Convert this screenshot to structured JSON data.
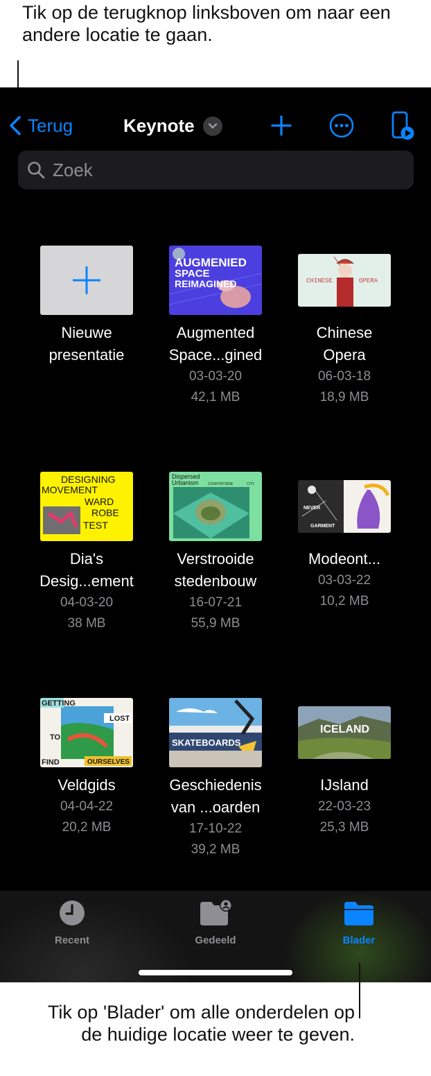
{
  "callouts": {
    "top": "Tik op de terugknop linksboven om naar een andere locatie te gaan.",
    "bottom": "Tik op 'Blader' om alle onderdelen op de huidige locatie weer te geven."
  },
  "nav": {
    "back_label": "Terug",
    "title": "Keynote",
    "icons": [
      "chevron-left-icon",
      "chevron-down-icon",
      "plus-icon",
      "more-icon",
      "play-device-icon"
    ]
  },
  "search": {
    "placeholder": "Zoek"
  },
  "colors": {
    "accent": "#0a84ff",
    "background": "#000000",
    "secondary_text": "#8e8e93"
  },
  "grid": {
    "new": {
      "label1": "Nieuwe",
      "label2": "presentatie"
    },
    "items": [
      {
        "line1": "Augmented",
        "line2": "Space...gined",
        "date": "03-03-20",
        "size": "42,1 MB"
      },
      {
        "line1": "Chinese",
        "line2": "Opera",
        "date": "06-03-18",
        "size": "18,9 MB"
      },
      {
        "line1": "Dia's",
        "line2": "Desig...ement",
        "date": "04-03-20",
        "size": "38 MB"
      },
      {
        "line1": "Verstrooide",
        "line2": "stedenbouw",
        "date": "16-07-21",
        "size": "55,9 MB"
      },
      {
        "line1": "Modeont...",
        "line2": "03-03-22",
        "date": "10,2 MB",
        "size": ""
      },
      {
        "line1": "Veldgids",
        "line2": "04-04-22",
        "date": "20,2 MB",
        "size": ""
      },
      {
        "line1": "Geschiedenis",
        "line2": "van ...oarden",
        "date": "17-10-22",
        "size": "39,2 MB"
      },
      {
        "line1": "IJsland",
        "line2": "22-03-23",
        "date": "25,3 MB",
        "size": ""
      }
    ],
    "thumb_text": {
      "augmented": [
        "AUGMENIED",
        "SPACE",
        "REIMAGINED"
      ],
      "chinese": [
        "CHINESE",
        "OPERA"
      ],
      "designing": [
        "DESIGNING",
        "MOVEMENT",
        "WARD",
        "ROBE",
        "TEST"
      ],
      "dispersed": [
        "Dispersed",
        "Urbanism",
        "COUNTRYSIDE",
        "CITY"
      ],
      "garment": [
        "NEVER",
        "GARMENT"
      ],
      "getting": [
        "GETTING",
        "LOST",
        "TO",
        "FIND",
        "OURSELVES"
      ],
      "skate": [
        "SKATEBOARDS"
      ],
      "iceland": [
        "ICELAND"
      ]
    }
  },
  "tabbar": {
    "recent": "Recent",
    "shared": "Gedeeld",
    "browse": "Blader"
  }
}
